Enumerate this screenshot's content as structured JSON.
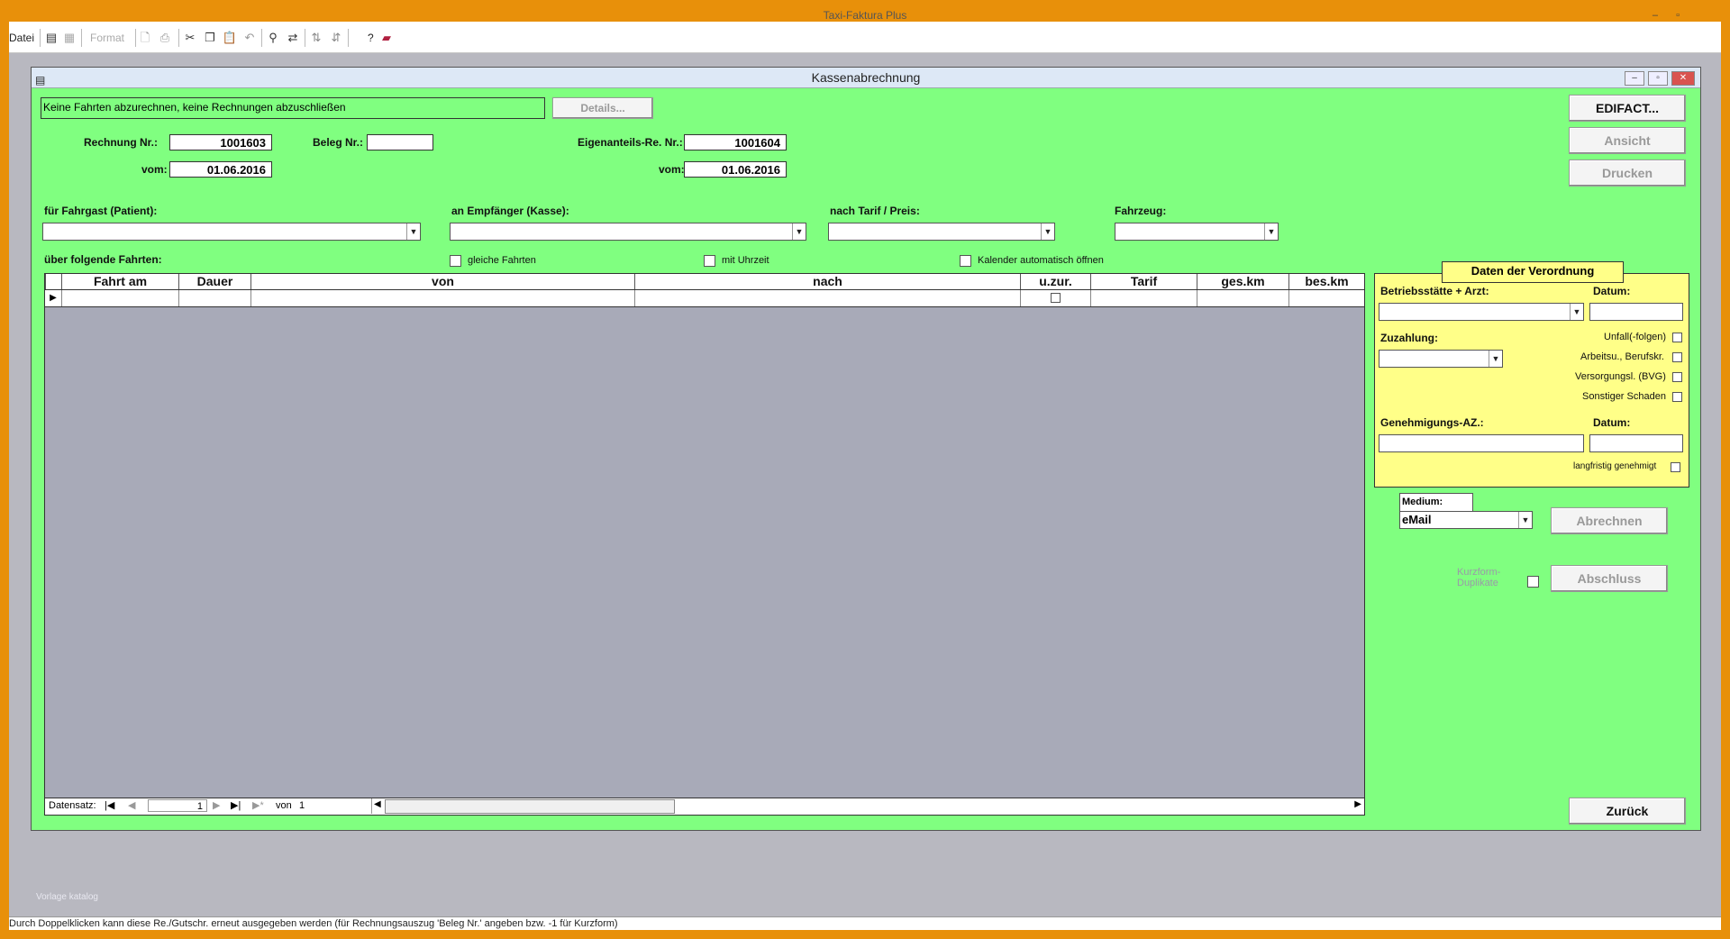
{
  "app": {
    "title": "Taxi-Faktura Plus"
  },
  "toolbar": {
    "menu_datei": "Datei",
    "format_label": "Format",
    "help_label": "?"
  },
  "form": {
    "title": "Kassenabrechnung",
    "info_text": "Keine Fahrten abzurechnen, keine Rechnungen abzuschließen",
    "details_button": "Details...",
    "rechnung_label": "Rechnung Nr.:",
    "rechnung_value": "1001603",
    "beleg_label": "Beleg Nr.:",
    "beleg_value": "",
    "vom_label": "vom:",
    "vom_value": "01.06.2016",
    "eigenanteil_label": "Eigenanteils-Re. Nr.:",
    "eigenanteil_value": "1001604",
    "vom2_label": "vom:",
    "vom2_value": "01.06.2016",
    "fahrgast_label": "für Fahrgast (Patient):",
    "empfaenger_label": "an Empfänger (Kasse):",
    "tarif_label": "nach Tarif / Preis:",
    "fahrzeug_label": "Fahrzeug:",
    "fahrten_label": "über folgende Fahrten:",
    "gleiche_label": "gleiche Fahrten",
    "uhrzeit_label": "mit Uhrzeit",
    "kalender_label": "Kalender automatisch öffnen"
  },
  "grid": {
    "columns": [
      "Fahrt am",
      "Dauer",
      "von",
      "nach",
      "u.zur.",
      "Tarif",
      "ges.km",
      "bes.km"
    ],
    "nav": {
      "label": "Datensatz:",
      "current": "1",
      "of_label": "von",
      "total": "1"
    }
  },
  "verordnung": {
    "title": "Daten der Verordnung",
    "betriebsstaette_label": "Betriebsstätte + Arzt:",
    "datum_label": "Datum:",
    "zuzahlung_label": "Zuzahlung:",
    "unfall_label": "Unfall(-folgen)",
    "arbeitsu_label": "Arbeitsu., Berufskr.",
    "versorgung_label": "Versorgungsl. (BVG)",
    "sonstiger_label": "Sonstiger Schaden",
    "genehmigung_label": "Genehmigungs-AZ.:",
    "datum2_label": "Datum:",
    "langfristig_label": "langfristig genehmigt"
  },
  "right": {
    "edifact": "EDIFACT...",
    "ansicht": "Ansicht",
    "drucken": "Drucken",
    "medium_label": "Medium:",
    "medium_value": "eMail",
    "abrechnen": "Abrechnen",
    "kurzform_label": "Kurzform-Duplikate",
    "abschluss": "Abschluss",
    "zurueck": "Zurück"
  },
  "footer": {
    "vorlage": "Vorlage katalog",
    "status": "Durch Doppelklicken kann diese Re./Gutschr. erneut ausgegeben werden (für Rechnungsauszug 'Beleg Nr.' angeben bzw. -1 für Kurzform)"
  }
}
